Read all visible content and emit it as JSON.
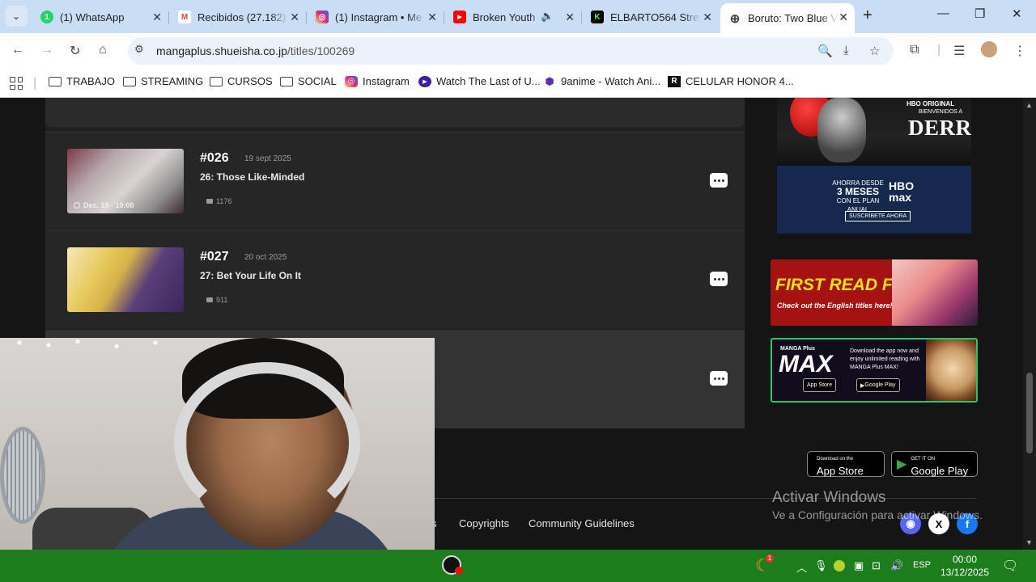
{
  "browser": {
    "tabs": [
      {
        "title": "(1) WhatsApp",
        "favicon": "whatsapp-icon",
        "color": "#25d366",
        "glyph": "1"
      },
      {
        "title": "Recibidos (27.182)",
        "favicon": "gmail-icon",
        "color": "#ea4335",
        "glyph": "M"
      },
      {
        "title": "(1) Instagram • Me",
        "favicon": "instagram-icon",
        "color": "#d62976",
        "glyph": "◎"
      },
      {
        "title": "Broken Youth",
        "favicon": "youtube-icon",
        "color": "#ff0000",
        "glyph": "▶"
      },
      {
        "title": "ELBARTO564 Strea",
        "favicon": "kick-icon",
        "color": "#53fc18",
        "glyph": "K"
      },
      {
        "title": "Boruto: Two Blue V",
        "favicon": "globe-icon",
        "color": "#5f6368",
        "glyph": "⊕"
      }
    ],
    "active_tab": 5,
    "url_host": "mangaplus.shueisha.co.jp",
    "url_path": "/titles/100269"
  },
  "bookmarks": [
    {
      "label": "TRABAJO",
      "icon": "folder-icon"
    },
    {
      "label": "STREAMING",
      "icon": "folder-icon"
    },
    {
      "label": "CURSOS",
      "icon": "folder-icon"
    },
    {
      "label": "SOCIAL",
      "icon": "folder-icon"
    },
    {
      "label": "Instagram",
      "icon": "instagram-icon"
    },
    {
      "label": "Watch The Last of U...",
      "icon": "play-icon"
    },
    {
      "label": "9anime - Watch Ani...",
      "icon": "9anime-icon"
    },
    {
      "label": "CELULAR HONOR 4...",
      "icon": "r-logo-icon"
    }
  ],
  "chapters": [
    {
      "number": "#026",
      "date": "19 sept 2025",
      "title": "26: Those Like-Minded",
      "comments": "1176",
      "timestamp": "Dec. 18 - 10:00"
    },
    {
      "number": "#027",
      "date": "20 oct 2025",
      "title": "27: Bet Your Life On It",
      "comments": "911"
    }
  ],
  "ads": {
    "derry": {
      "hbo_original": "HBO ORIGINAL",
      "welcome": "BIENVENIDOS A",
      "title": "DERRY",
      "promo_top": "AHORRA DESDE",
      "promo_big": "3 MESES",
      "promo_bottom": "CON EL PLAN ANUAL",
      "brand_top": "HBO",
      "brand_bottom": "max",
      "cta": "SUSCRÍBETE AHORA"
    },
    "first_read": {
      "title": "FIRST READ FREE!!",
      "subtitle": "Check out the English titles here! ▸"
    },
    "manga_max": {
      "brand": "MANGA Plus",
      "title": "MAX",
      "text": "Download the app now and enjoy unlimited reading with MANGA Plus MAX!",
      "app_store": "App Store",
      "google_play": "Google Play"
    }
  },
  "footer": {
    "app_store_small": "Download on the",
    "app_store": "App Store",
    "google_play_small": "GET IT ON",
    "google_play": "Google Play",
    "links": [
      {
        "label": "s"
      },
      {
        "label": "Copyrights"
      },
      {
        "label": "Community Guidelines"
      }
    ]
  },
  "activation": {
    "heading": "Activar Windows",
    "text": "Ve a Configuración para activar Windows."
  },
  "taskbar": {
    "language": "ESP",
    "time": "00:00",
    "date": "13/12/2025",
    "notification_count": "1"
  },
  "colors": {
    "page_bg": "#141414",
    "taskbar": "#1d7d1c",
    "tab_strip": "#c9ddf4"
  }
}
